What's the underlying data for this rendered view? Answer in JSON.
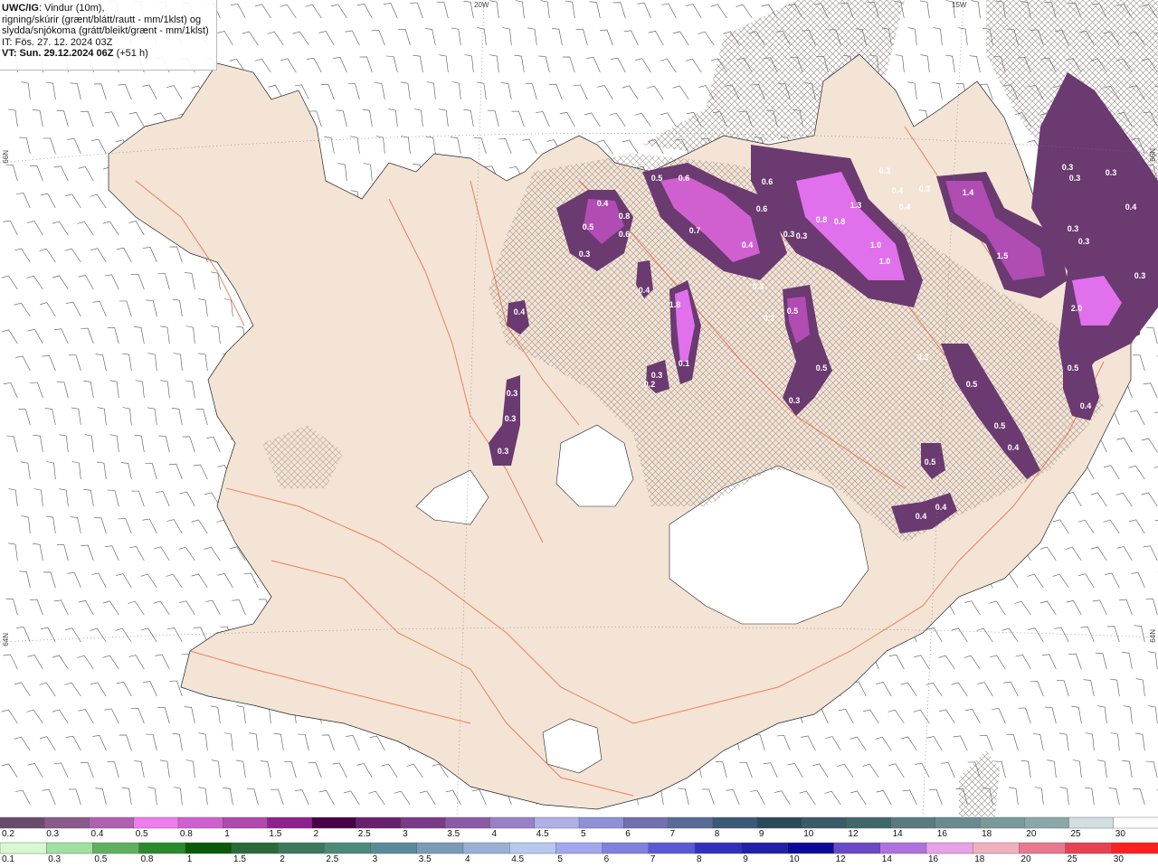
{
  "header": {
    "title_bold": "UWC/IG",
    "title_rest": ": Vindur (10m),",
    "line2": "rigning/skúrir (grænt/blátt/rautt - mm/1klst) og",
    "line3": "slydda/snjókoma (grátt/bleikt/grænt - mm/1klst)",
    "it_line": "IT: Fös. 27. 12. 2024 03Z",
    "vt_bold": "VT: Sun. 29.12.2024 06Z",
    "vt_rest": " (+51 h)"
  },
  "coords": {
    "top_20w": "20W",
    "top_15w": "15W",
    "left_66n": "66N",
    "left_64n": "64N",
    "right_66n": "66N",
    "right_64n": "64N"
  },
  "colors": {
    "land": "#f3e4d6",
    "roads": "#e8663a",
    "precip_light": "#6b3a70",
    "precip_mid": "#b04cb4",
    "precip_heavy": "#e070ec",
    "hatch": "#9a8a86"
  },
  "precip_labels": [
    "0.3",
    "0.3",
    "0.3",
    "0.3",
    "1.4",
    "0.4",
    "0.3",
    "0.4",
    "0.5",
    "0.6",
    "0.6",
    "0.6",
    "1.3",
    "0.8",
    "0.8",
    "0.5",
    "0.3",
    "0.3",
    "1.0",
    "1.0",
    "0.3",
    "0.3",
    "0.4",
    "0.7",
    "0.8",
    "0.4",
    "0.6",
    "0.4",
    "0.5",
    "1.5",
    "0.3",
    "2.0",
    "0.3",
    "0.4",
    "0.4",
    "0.3",
    "1.8",
    "0.3",
    "0.5",
    "0.3",
    "0.5",
    "0.5",
    "0.3",
    "0.4",
    "0.1",
    "0.3",
    "0.5",
    "0.5",
    "0.4",
    "0.4",
    "0.2",
    "0.3",
    "0.4",
    "0.3",
    "0.1",
    "0.3"
  ],
  "legend_snow": {
    "values": [
      "0.2",
      "0.3",
      "0.4",
      "0.5",
      "0.8",
      "1",
      "1.5",
      "2",
      "2.5",
      "3",
      "3.5",
      "4",
      "4.5",
      "5",
      "6",
      "7",
      "8",
      "9",
      "10",
      "12",
      "14",
      "16",
      "18",
      "20",
      "25",
      "30"
    ],
    "colors": [
      "#6b4a70",
      "#8a5a8c",
      "#b060b0",
      "#f07cf0",
      "#d060d0",
      "#b048b0",
      "#902090",
      "#4a0048",
      "#6a2070",
      "#7a3a8a",
      "#8a5aa8",
      "#9a80c8",
      "#b0b0e8",
      "#9090d8",
      "#7070b0",
      "#5a6a98",
      "#3a5a78",
      "#2a4a5a",
      "#3a5a68",
      "#40686a",
      "#5a7a80",
      "#6a8a90",
      "#7a9a9a",
      "#8aa8a8",
      "#d0e0e0",
      "#ffffff"
    ]
  },
  "legend_rain": {
    "values": [
      "0.1",
      "0.3",
      "0.5",
      "0.8",
      "1",
      "1.5",
      "2",
      "2.5",
      "3",
      "3.5",
      "4",
      "4.5",
      "5",
      "6",
      "7",
      "8",
      "9",
      "10",
      "12",
      "14",
      "16",
      "18",
      "20",
      "25",
      "30"
    ],
    "colors": [
      "#d8f8d0",
      "#a0e0a0",
      "#60b060",
      "#2a8a2a",
      "#0a5a0a",
      "#2a6a3a",
      "#3a7a5a",
      "#4a8a7a",
      "#5a8a9a",
      "#7a9ab8",
      "#9ab0d8",
      "#b8c8f0",
      "#a0a8f0",
      "#8080e0",
      "#5a5ad8",
      "#3030c0",
      "#2020a8",
      "#0a0a9a",
      "#6a48c8",
      "#b070e0",
      "#e8a0e8",
      "#f0b0c0",
      "#e87890",
      "#e84050",
      "#ff2020"
    ]
  }
}
